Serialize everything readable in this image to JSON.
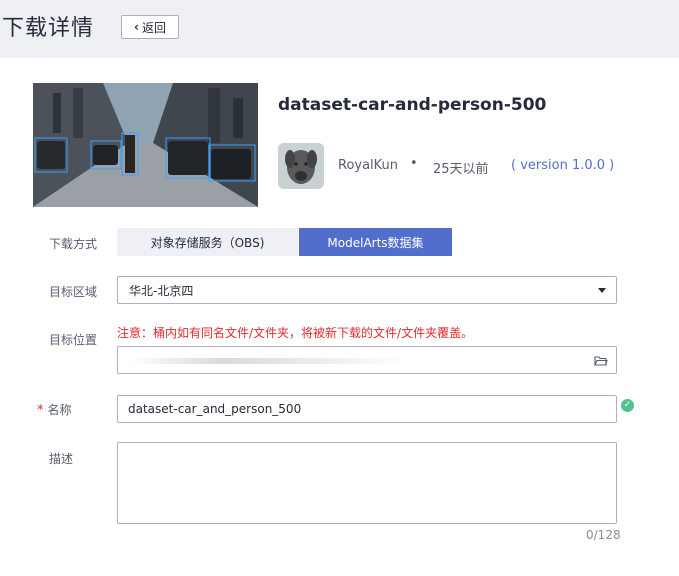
{
  "page": {
    "title": "下载详情",
    "back_label": "返回"
  },
  "dataset": {
    "name": "dataset-car-and-person-500",
    "author": "RoyalKun",
    "separator": "•",
    "time": "25天以前",
    "version": "( version 1.0.0 )"
  },
  "form": {
    "method_label": "下载方式",
    "methods": [
      "对象存储服务（OBS)",
      "ModelArts数据集"
    ],
    "region_label": "目标区域",
    "region_value": "华北-北京四",
    "location_label": "目标位置",
    "location_warning": "注意：桶内如有同名文件/文件夹，将被新下载的文件/文件夹覆盖。",
    "name_required": "*",
    "name_label": "名称",
    "name_value": "dataset-car_and_person_500",
    "desc_label": "描述",
    "desc_value": "",
    "desc_counter": "0/128"
  },
  "colors": {
    "accent": "#526ecc",
    "warning": "#e02d2d",
    "success": "#50c28d"
  }
}
